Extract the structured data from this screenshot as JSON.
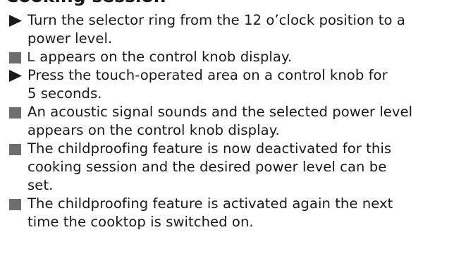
{
  "section_heading": "Cooking session",
  "steps": [
    {
      "type": "action",
      "icon": "triangle-right-icon",
      "lines": [
        "Turn the selector ring from the 12 o’clock position to a",
        "power level."
      ]
    },
    {
      "type": "result",
      "icon": "square-bullet-icon",
      "symbol": "L",
      "lines": [
        "appears on the control knob display."
      ]
    },
    {
      "type": "action",
      "icon": "triangle-right-icon",
      "lines": [
        "Press the touch-operated area on a control knob for",
        "5 seconds."
      ]
    },
    {
      "type": "result",
      "icon": "square-bullet-icon",
      "lines": [
        "An acoustic signal sounds and the selected power level",
        "appears on the control knob display."
      ]
    },
    {
      "type": "result",
      "icon": "square-bullet-icon",
      "lines": [
        "The childproofing feature is now deactivated for this",
        "cooking session and the desired power level can be",
        "set."
      ]
    },
    {
      "type": "result",
      "icon": "square-bullet-icon",
      "lines": [
        "The childproofing feature is activated again the next",
        "time the cooktop is switched on."
      ]
    }
  ]
}
